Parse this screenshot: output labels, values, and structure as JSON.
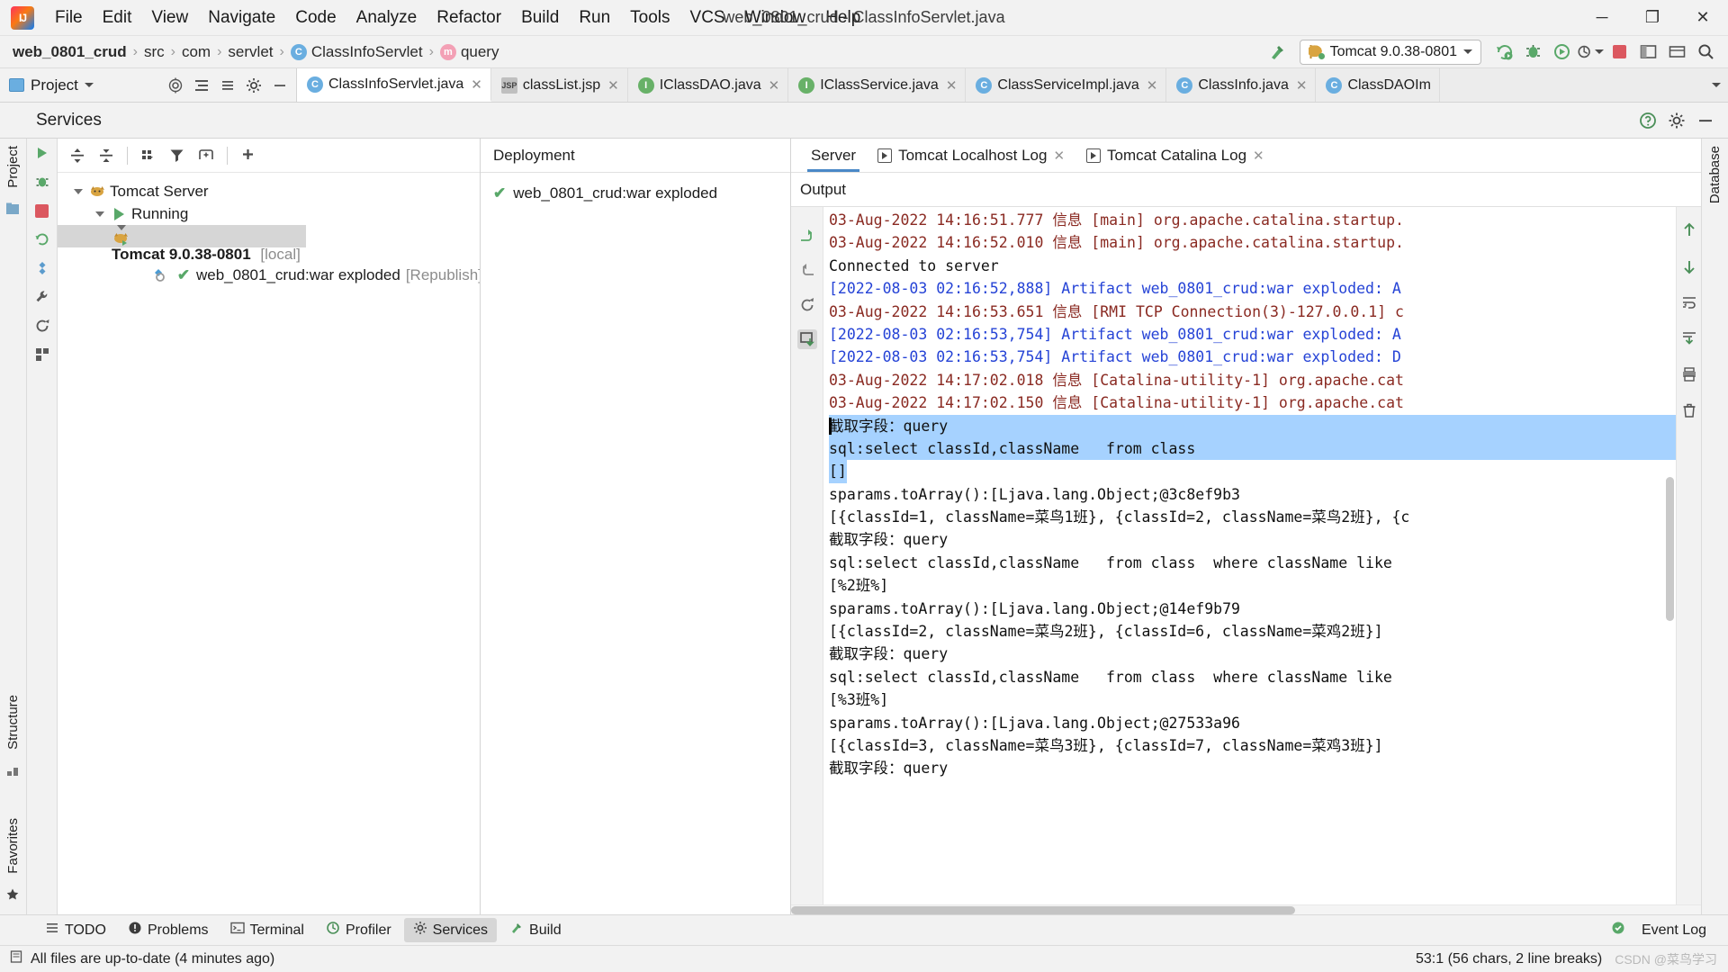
{
  "window": {
    "title": "web_0801_crud - ClassInfoServlet.java",
    "minimize": "─",
    "maximize": "❐",
    "close": "✕"
  },
  "menu": {
    "items": [
      "File",
      "Edit",
      "View",
      "Navigate",
      "Code",
      "Analyze",
      "Refactor",
      "Build",
      "Run",
      "Tools",
      "VCS",
      "Window",
      "Help"
    ]
  },
  "breadcrumb": {
    "items": [
      {
        "label": "web_0801_crud",
        "bold": true,
        "icon": ""
      },
      {
        "label": "src",
        "bold": false,
        "icon": ""
      },
      {
        "label": "com",
        "bold": false,
        "icon": ""
      },
      {
        "label": "servlet",
        "bold": false,
        "icon": ""
      },
      {
        "label": "ClassInfoServlet",
        "bold": false,
        "icon": "class-icon"
      },
      {
        "label": "query",
        "bold": false,
        "icon": "method-icon"
      }
    ],
    "separator": "›"
  },
  "toolbar": {
    "build_hammer": "build-icon",
    "run_config": "Tomcat 9.0.38-0801",
    "update_label": "update-icon",
    "debug_label": "debug-icon",
    "coverage_label": "coverage-icon",
    "profile_label": "profile-icon",
    "stop_label": "stop-icon",
    "search_label": "search-icon"
  },
  "project_panel": {
    "label": "Project",
    "dropdown": "▾"
  },
  "editor_tabs": [
    {
      "label": "ClassInfoServlet.java",
      "icon": "class-icon",
      "active": true
    },
    {
      "label": "classList.jsp",
      "icon": "jsp-icon",
      "active": false
    },
    {
      "label": "IClassDAO.java",
      "icon": "interface-icon",
      "active": false
    },
    {
      "label": "IClassService.java",
      "icon": "interface-icon",
      "active": false
    },
    {
      "label": "ClassServiceImpl.java",
      "icon": "class-icon",
      "active": false
    },
    {
      "label": "ClassInfo.java",
      "icon": "class-icon",
      "active": false
    },
    {
      "label": "ClassDAOIm",
      "icon": "class-icon",
      "active": false
    }
  ],
  "services": {
    "title": "Services",
    "tree": [
      {
        "label": "Tomcat Server",
        "depth": 0,
        "icon": "tomcat-icon",
        "expanded": true,
        "selected": false,
        "bold": false,
        "suffix": ""
      },
      {
        "label": "Running",
        "depth": 1,
        "icon": "run-icon",
        "expanded": true,
        "selected": false,
        "bold": false,
        "suffix": ""
      },
      {
        "label": "Tomcat 9.0.38-0801",
        "depth": 2,
        "icon": "tomcat-icon",
        "expanded": true,
        "selected": true,
        "bold": true,
        "suffix": "[local]"
      },
      {
        "label": "web_0801_crud:war exploded",
        "depth": 3,
        "icon": "artifact-icon",
        "expanded": false,
        "selected": false,
        "bold": false,
        "suffix": "[Republish]"
      }
    ]
  },
  "deployment": {
    "header": "Deployment",
    "items": [
      {
        "label": "web_0801_crud:war exploded",
        "status": "✔"
      }
    ]
  },
  "console": {
    "header": "Output",
    "tabs": [
      {
        "label": "Server",
        "active": true,
        "closable": false,
        "icon": ""
      },
      {
        "label": "Tomcat Localhost Log",
        "active": false,
        "closable": true,
        "icon": "run-icon"
      },
      {
        "label": "Tomcat Catalina Log",
        "active": false,
        "closable": true,
        "icon": "run-icon"
      }
    ],
    "lines": [
      {
        "text": "03-Aug-2022 14:16:51.777 信息 [main] org.apache.catalina.startup.",
        "color": "red",
        "selected": false,
        "clipped": true
      },
      {
        "text": "03-Aug-2022 14:16:52.010 信息 [main] org.apache.catalina.startup.",
        "color": "red",
        "selected": false
      },
      {
        "text": "Connected to server",
        "color": "black",
        "selected": false
      },
      {
        "text": "[2022-08-03 02:16:52,888] Artifact web_0801_crud:war exploded: A",
        "color": "blue",
        "selected": false
      },
      {
        "text": "03-Aug-2022 14:16:53.651 信息 [RMI TCP Connection(3)-127.0.0.1] c",
        "color": "red",
        "selected": false
      },
      {
        "text": "[2022-08-03 02:16:53,754] Artifact web_0801_crud:war exploded: A",
        "color": "blue",
        "selected": false
      },
      {
        "text": "[2022-08-03 02:16:53,754] Artifact web_0801_crud:war exploded: D",
        "color": "blue",
        "selected": false
      },
      {
        "text": "03-Aug-2022 14:17:02.018 信息 [Catalina-utility-1] org.apache.cat",
        "color": "red",
        "selected": false
      },
      {
        "text": "03-Aug-2022 14:17:02.150 信息 [Catalina-utility-1] org.apache.cat",
        "color": "red",
        "selected": false
      },
      {
        "text": "截取字段：query",
        "color": "black",
        "selected": true,
        "caret": true
      },
      {
        "text": "sql:select classId,className   from class",
        "color": "black",
        "selected": true
      },
      {
        "text": "[]",
        "color": "black",
        "selected": true,
        "partial": true
      },
      {
        "text": "sparams.toArray():[Ljava.lang.Object;@3c8ef9b3",
        "color": "black",
        "selected": false
      },
      {
        "text": "[{classId=1, className=菜鸟1班}, {classId=2, className=菜鸟2班}, {c",
        "color": "black",
        "selected": false
      },
      {
        "text": "截取字段：query",
        "color": "black",
        "selected": false
      },
      {
        "text": "sql:select classId,className   from class  where className like",
        "color": "black",
        "selected": false
      },
      {
        "text": "[%2班%]",
        "color": "black",
        "selected": false
      },
      {
        "text": "sparams.toArray():[Ljava.lang.Object;@14ef9b79",
        "color": "black",
        "selected": false
      },
      {
        "text": "[{classId=2, className=菜鸟2班}, {classId=6, className=菜鸡2班}]",
        "color": "black",
        "selected": false
      },
      {
        "text": "截取字段：query",
        "color": "black",
        "selected": false
      },
      {
        "text": "sql:select classId,className   from class  where className like",
        "color": "black",
        "selected": false
      },
      {
        "text": "[%3班%]",
        "color": "black",
        "selected": false
      },
      {
        "text": "sparams.toArray():[Ljava.lang.Object;@27533a96",
        "color": "black",
        "selected": false
      },
      {
        "text": "[{classId=3, className=菜鸟3班}, {classId=7, className=菜鸡3班}]",
        "color": "black",
        "selected": false
      },
      {
        "text": "截取字段：query",
        "color": "black",
        "selected": false,
        "clipped": true
      }
    ]
  },
  "bottom_bar": {
    "items": [
      {
        "label": "TODO",
        "icon": "todo-icon",
        "active": false
      },
      {
        "label": "Problems",
        "icon": "problems-icon",
        "active": false
      },
      {
        "label": "Terminal",
        "icon": "terminal-icon",
        "active": false
      },
      {
        "label": "Profiler",
        "icon": "profiler-icon",
        "active": false
      },
      {
        "label": "Services",
        "icon": "services-icon",
        "active": true
      },
      {
        "label": "Build",
        "icon": "build-icon",
        "active": false
      }
    ],
    "event_log": "Event Log"
  },
  "status_bar": {
    "message": "All files are up-to-date (4 minutes ago)",
    "position": "53:1 (56 chars, 2 line breaks)",
    "watermark": "CSDN @菜鸟学习"
  },
  "right_strip": {
    "database": "Database"
  },
  "left_strip": {
    "project": "Project",
    "structure": "Structure",
    "favorites": "Favorites"
  }
}
